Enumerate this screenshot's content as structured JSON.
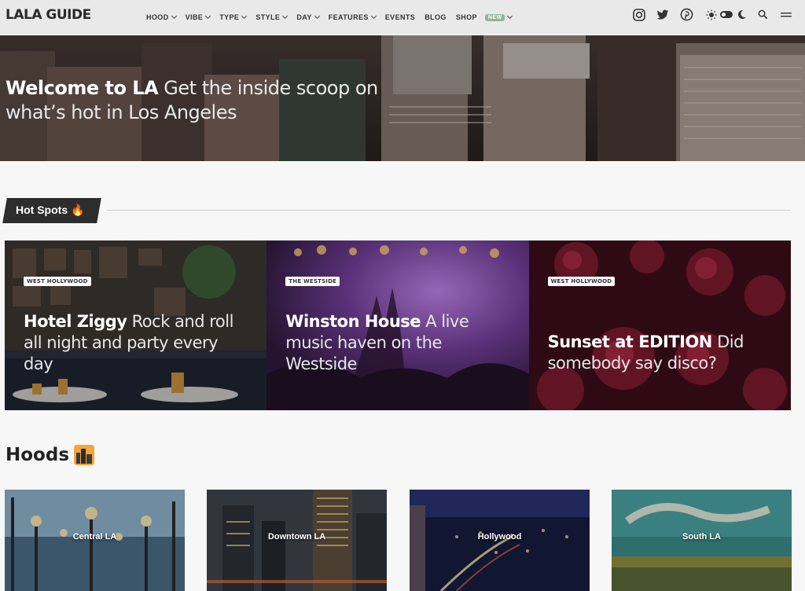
{
  "nav": {
    "logo": "LALA GUIDE",
    "items": [
      {
        "label": "HOOD",
        "dropdown": true
      },
      {
        "label": "VIBE",
        "dropdown": true
      },
      {
        "label": "TYPE",
        "dropdown": true
      },
      {
        "label": "STYLE",
        "dropdown": true
      },
      {
        "label": "DAY",
        "dropdown": true
      },
      {
        "label": "FEATURES",
        "dropdown": true
      },
      {
        "label": "EVENTS",
        "dropdown": false
      },
      {
        "label": "BLOG",
        "dropdown": false
      },
      {
        "label": "SHOP",
        "dropdown": false
      }
    ],
    "new_badge": "NEW",
    "icons": [
      "instagram-icon",
      "twitter-icon",
      "pinterest-icon",
      "sun-icon",
      "toggle-switch",
      "moon-icon",
      "search-icon",
      "menu-icon"
    ]
  },
  "hero": {
    "bold": "Welcome to LA",
    "text": " Get the inside scoop on what’s hot in Los Angeles"
  },
  "hot_spots": {
    "title": "Hot Spots 🔥",
    "cards": [
      {
        "badge": "WEST HOLLYWOOD",
        "name": "Hotel Ziggy",
        "desc": " Rock and roll all night and party every day"
      },
      {
        "badge": "THE WESTSIDE",
        "name": "Winston House",
        "desc": " A live music haven on the Westside"
      },
      {
        "badge": "WEST HOLLYWOOD",
        "name": "Sunset at EDITION",
        "desc": " Did somebody say disco?"
      }
    ]
  },
  "hoods": {
    "title": "Hoods",
    "items": [
      {
        "label": "Central LA"
      },
      {
        "label": "Downtown LA"
      },
      {
        "label": "Hollywood"
      },
      {
        "label": "South LA"
      }
    ]
  },
  "colors": {
    "nav_bg": "#e9e9e9",
    "tab_bg": "#2d2d2d",
    "new_badge": "#8fb59d"
  }
}
